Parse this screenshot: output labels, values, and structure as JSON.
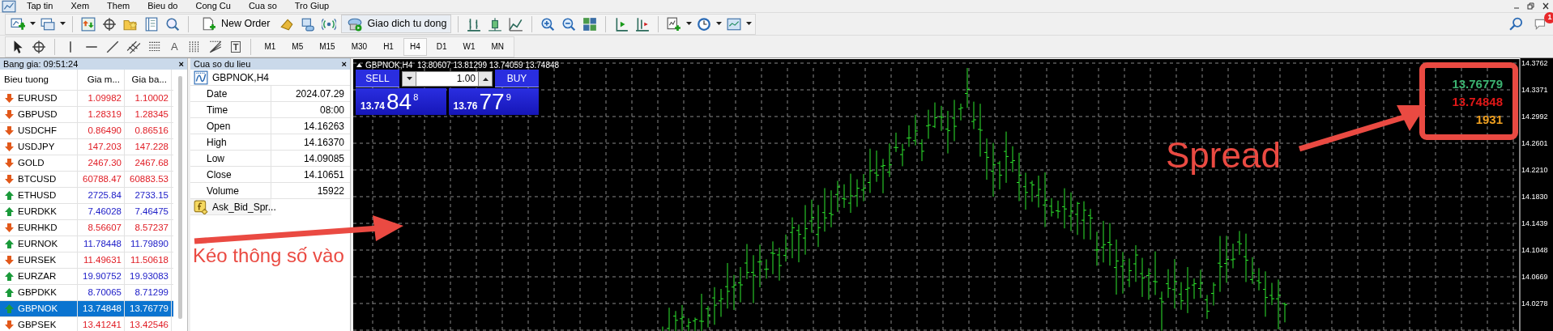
{
  "menu": [
    "Tap tin",
    "Xem",
    "Them",
    "Bieu do",
    "Cong Cu",
    "Cua so",
    "Tro Giup"
  ],
  "toolbar": {
    "new_order": "New Order",
    "auto_trading": "Giao dich tu dong"
  },
  "drawing_tools": {
    "text_tool": "A",
    "label_tool": "T"
  },
  "timeframes": [
    {
      "label": "M1",
      "selected": false
    },
    {
      "label": "M5",
      "selected": false
    },
    {
      "label": "M15",
      "selected": false
    },
    {
      "label": "M30",
      "selected": false
    },
    {
      "label": "H1",
      "selected": false
    },
    {
      "label": "H4",
      "selected": true
    },
    {
      "label": "D1",
      "selected": false
    },
    {
      "label": "W1",
      "selected": false
    },
    {
      "label": "MN",
      "selected": false
    }
  ],
  "notifications": {
    "badge": "1"
  },
  "market_watch": {
    "title": "Bang gia: 09:51:24",
    "close": "×",
    "columns": [
      "Bieu tuong",
      "Gia m...",
      "Gia ba..."
    ],
    "rows": [
      {
        "symbol": "EURUSD",
        "bid": "1.09982",
        "ask": "1.10002",
        "up": false,
        "selected": false
      },
      {
        "symbol": "GBPUSD",
        "bid": "1.28319",
        "ask": "1.28345",
        "up": false,
        "selected": false
      },
      {
        "symbol": "USDCHF",
        "bid": "0.86490",
        "ask": "0.86516",
        "up": false,
        "selected": false
      },
      {
        "symbol": "USDJPY",
        "bid": "147.203",
        "ask": "147.228",
        "up": false,
        "selected": false
      },
      {
        "symbol": "GOLD",
        "bid": "2467.30",
        "ask": "2467.68",
        "up": false,
        "selected": false
      },
      {
        "symbol": "BTCUSD",
        "bid": "60788.47",
        "ask": "60883.53",
        "up": false,
        "selected": false
      },
      {
        "symbol": "ETHUSD",
        "bid": "2725.84",
        "ask": "2733.15",
        "up": true,
        "selected": false
      },
      {
        "symbol": "EURDKK",
        "bid": "7.46028",
        "ask": "7.46475",
        "up": true,
        "selected": false
      },
      {
        "symbol": "EURHKD",
        "bid": "8.56607",
        "ask": "8.57237",
        "up": false,
        "selected": false
      },
      {
        "symbol": "EURNOK",
        "bid": "11.78448",
        "ask": "11.79890",
        "up": true,
        "selected": false
      },
      {
        "symbol": "EURSEK",
        "bid": "11.49631",
        "ask": "11.50618",
        "up": false,
        "selected": false
      },
      {
        "symbol": "EURZAR",
        "bid": "19.90752",
        "ask": "19.93083",
        "up": true,
        "selected": false
      },
      {
        "symbol": "GBPDKK",
        "bid": "8.70065",
        "ask": "8.71299",
        "up": true,
        "selected": false
      },
      {
        "symbol": "GBPNOK",
        "bid": "13.74848",
        "ask": "13.76779",
        "up": true,
        "selected": true
      },
      {
        "symbol": "GBPSEK",
        "bid": "13.41241",
        "ask": "13.42546",
        "up": false,
        "selected": false
      }
    ]
  },
  "data_window": {
    "title": "Cua so du lieu",
    "close": "×",
    "header": "GBPNOK,H4",
    "rows": [
      {
        "label": "Date",
        "value": "2024.07.29"
      },
      {
        "label": "Time",
        "value": "08:00"
      },
      {
        "label": "Open",
        "value": "14.16263"
      },
      {
        "label": "High",
        "value": "14.16370"
      },
      {
        "label": "Low",
        "value": "14.09085"
      },
      {
        "label": "Close",
        "value": "14.10651"
      },
      {
        "label": "Volume",
        "value": "15922"
      }
    ],
    "indicator": "Ask_Bid_Spr..."
  },
  "chart": {
    "header": "GBPNOK,H4  13.80607 13.81299 13.74059 13.74848",
    "trade_panel": {
      "sell": "SELL",
      "buy": "BUY",
      "lot": "1.00",
      "bid": {
        "big_figure": "13.74",
        "pips": "84",
        "fraction": "8"
      },
      "ask": {
        "big_figure": "13.76",
        "pips": "77",
        "fraction": "9"
      }
    },
    "indicator": [
      {
        "text": "13.76779",
        "color": "#3cb371"
      },
      {
        "text": "13.74848",
        "color": "#e01818"
      },
      {
        "text": "1931",
        "color": "#f0a020"
      }
    ],
    "price_axis": [
      "14.3762",
      "14.3371",
      "14.2992",
      "14.2601",
      "14.2210",
      "14.1830",
      "14.1439",
      "14.1048",
      "14.0669",
      "14.0278"
    ]
  },
  "annotations": {
    "drag_hint": "Kéo thông số vào",
    "spread_label": "Spread"
  }
}
